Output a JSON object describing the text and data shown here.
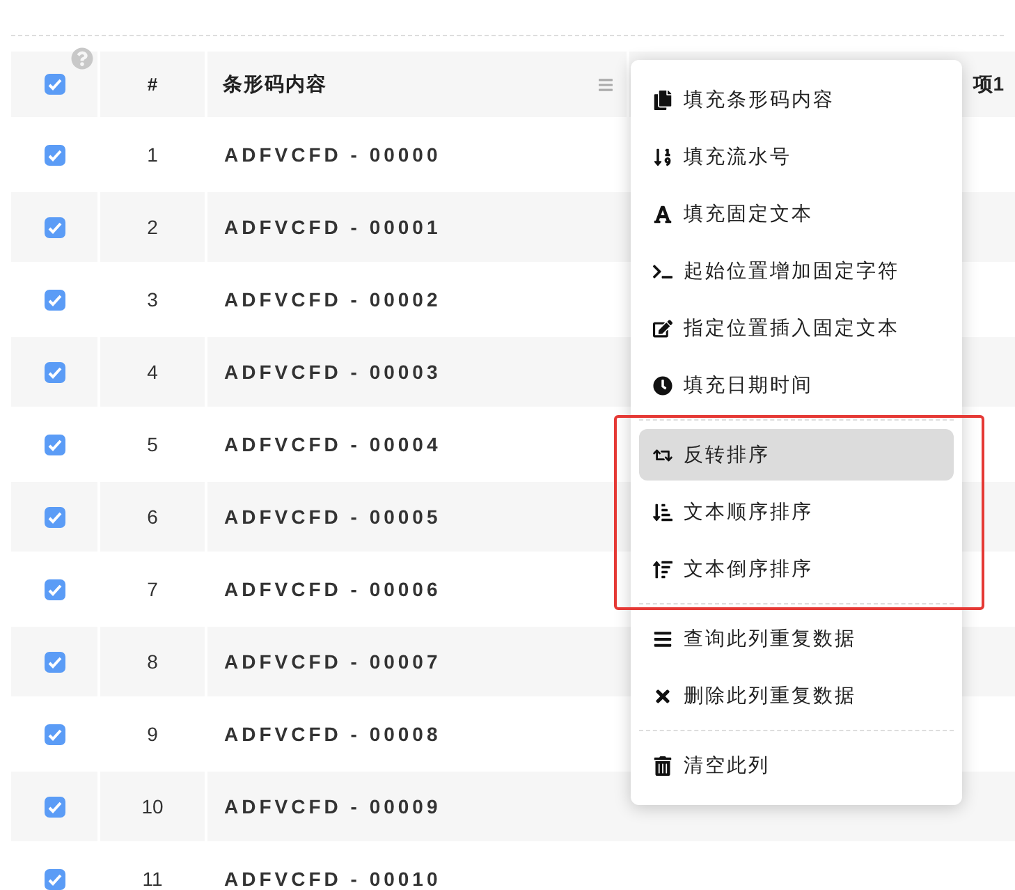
{
  "table": {
    "select_all": {
      "checked": true
    },
    "columns": [
      "#",
      "条形码内容",
      "项1"
    ],
    "rows": [
      {
        "index": "1",
        "content": "ADFVCFD - 00000",
        "checked": true
      },
      {
        "index": "2",
        "content": "ADFVCFD - 00001",
        "checked": true
      },
      {
        "index": "3",
        "content": "ADFVCFD - 00002",
        "checked": true
      },
      {
        "index": "4",
        "content": "ADFVCFD - 00003",
        "checked": true
      },
      {
        "index": "5",
        "content": "ADFVCFD - 00004",
        "checked": true
      },
      {
        "index": "6",
        "content": "ADFVCFD - 00005",
        "checked": true
      },
      {
        "index": "7",
        "content": "ADFVCFD - 00006",
        "checked": true
      },
      {
        "index": "8",
        "content": "ADFVCFD - 00007",
        "checked": true
      },
      {
        "index": "9",
        "content": "ADFVCFD - 00008",
        "checked": true
      },
      {
        "index": "10",
        "content": "ADFVCFD - 00009",
        "checked": true
      },
      {
        "index": "11",
        "content": "ADFVCFD - 00010",
        "checked": true
      }
    ]
  },
  "context_menu": {
    "groups": [
      {
        "outlined": false,
        "items": [
          {
            "label": "填充条形码内容",
            "selected": false
          },
          {
            "label": "填充流水号",
            "selected": false
          },
          {
            "label": "填充固定文本",
            "selected": false
          },
          {
            "label": "起始位置增加固定字符",
            "selected": false
          },
          {
            "label": "指定位置插入固定文本",
            "selected": false
          },
          {
            "label": "填充日期时间",
            "selected": false
          }
        ]
      },
      {
        "outlined": true,
        "items": [
          {
            "label": "反转排序",
            "selected": true
          },
          {
            "label": "文本顺序排序",
            "selected": false
          },
          {
            "label": "文本倒序排序",
            "selected": false
          }
        ]
      },
      {
        "outlined": false,
        "items": [
          {
            "label": "查询此列重复数据",
            "selected": false
          },
          {
            "label": "删除此列重复数据",
            "selected": false
          }
        ]
      },
      {
        "outlined": false,
        "items": [
          {
            "label": "清空此列",
            "selected": false
          }
        ]
      }
    ]
  }
}
